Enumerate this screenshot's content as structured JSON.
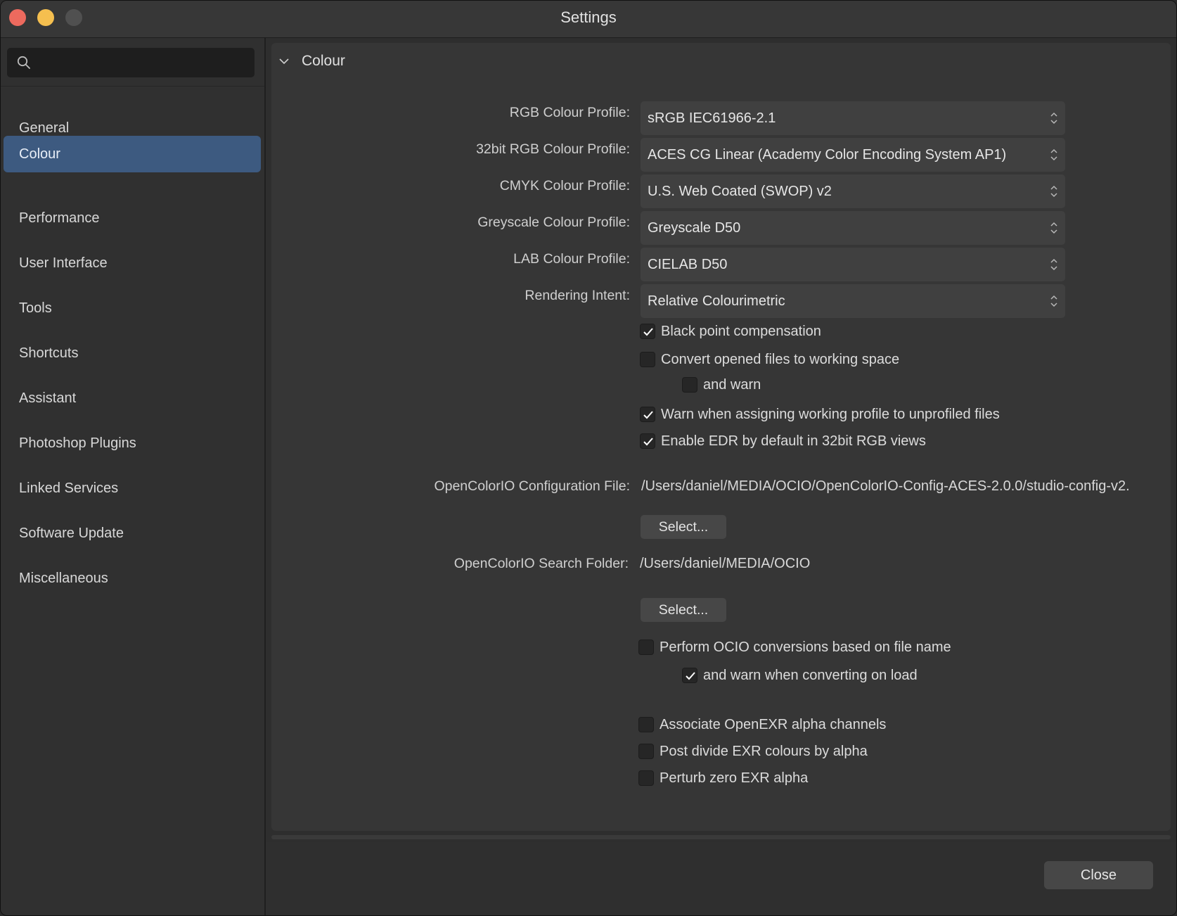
{
  "window": {
    "title": "Settings"
  },
  "sidebar": {
    "search_placeholder": "",
    "items": [
      {
        "label": "General"
      },
      {
        "label": "Colour",
        "active": true
      },
      {
        "label": "Performance"
      },
      {
        "label": "User Interface"
      },
      {
        "label": "Tools"
      },
      {
        "label": "Shortcuts"
      },
      {
        "label": "Assistant"
      },
      {
        "label": "Photoshop Plugins"
      },
      {
        "label": "Linked Services"
      },
      {
        "label": "Software Update"
      },
      {
        "label": "Miscellaneous"
      }
    ]
  },
  "section": {
    "title": "Colour"
  },
  "profiles": [
    {
      "label": "RGB Colour Profile:",
      "value": "sRGB IEC61966-2.1"
    },
    {
      "label": "32bit RGB Colour Profile:",
      "value": "ACES CG Linear (Academy Color Encoding System AP1)"
    },
    {
      "label": "CMYK Colour Profile:",
      "value": "U.S. Web Coated (SWOP) v2"
    },
    {
      "label": "Greyscale Colour Profile:",
      "value": "Greyscale D50"
    },
    {
      "label": "LAB Colour Profile:",
      "value": "CIELAB D50"
    },
    {
      "label": "Rendering Intent:",
      "value": "Relative Colourimetric"
    }
  ],
  "checks": {
    "black_point": {
      "label": "Black point compensation",
      "checked": true
    },
    "convert_opened": {
      "label": "Convert opened files to working space",
      "checked": false
    },
    "and_warn": {
      "label": "and warn",
      "checked": false
    },
    "warn_assigning": {
      "label": "Warn when assigning working profile to unprofiled files",
      "checked": true
    },
    "enable_edr": {
      "label": "Enable EDR by default in 32bit RGB views",
      "checked": true
    },
    "perform_ocio": {
      "label": "Perform OCIO conversions based on file name",
      "checked": false
    },
    "warn_converting": {
      "label": "and warn when converting on load",
      "checked": true
    },
    "associate_exr": {
      "label": "Associate OpenEXR alpha channels",
      "checked": false
    },
    "post_divide": {
      "label": "Post divide EXR colours by alpha",
      "checked": false
    },
    "perturb_zero": {
      "label": "Perturb zero EXR alpha",
      "checked": false
    }
  },
  "ocio": {
    "config_label": "OpenColorIO Configuration File:",
    "config_path": "/Users/daniel/MEDIA/OCIO/OpenColorIO-Config-ACES-2.0.0/studio-config-v2.",
    "select_label": "Select...",
    "folder_label": "OpenColorIO Search Folder:",
    "folder_path": "/Users/daniel/MEDIA/OCIO",
    "select_label_2": "Select..."
  },
  "footer": {
    "close_label": "Close"
  },
  "colors": {
    "accent": "#3d5a80",
    "close": "#ed6a5e",
    "minimize": "#f5bf4f",
    "maximize": "#505050"
  }
}
